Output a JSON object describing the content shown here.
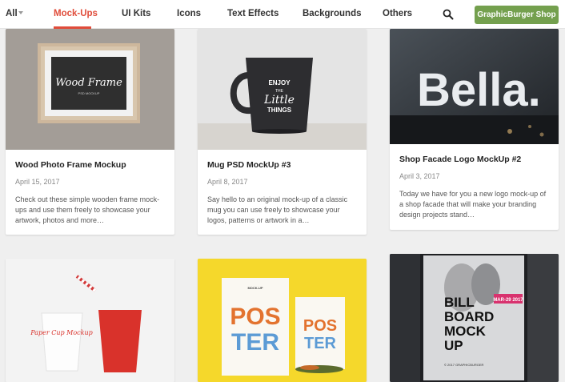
{
  "nav": {
    "all_label": "All",
    "items": [
      {
        "label": "Mock-Ups"
      },
      {
        "label": "UI Kits"
      },
      {
        "label": "Icons"
      },
      {
        "label": "Text Effects"
      },
      {
        "label": "Backgrounds"
      },
      {
        "label": "Others"
      }
    ],
    "shop_button": "GraphicBurger Shop"
  },
  "cards": [
    {
      "title": "Wood Photo Frame Mockup",
      "date": "April 15, 2017",
      "description": "Check out these simple wooden frame mock-ups and use them freely to showcase your artwork, photos and more…",
      "thumb_text": "Wood Frame",
      "thumb_subtext": "PSD MOCKUP"
    },
    {
      "title": "Mug PSD MockUp #3",
      "date": "April 8, 2017",
      "description": "Say hello to an original mock-up of a classic mug you can use freely to showcase your logos, patterns or artwork in a…",
      "thumb_text_1": "ENJOY",
      "thumb_text_2": "THE",
      "thumb_text_3": "Little",
      "thumb_text_4": "THINGS"
    },
    {
      "title": "Shop Facade Logo MockUp #2",
      "date": "April 3, 2017",
      "description": "Today we have for you a new logo mock-up of a shop facade that will make your branding design projects stand…",
      "thumb_text": "Bella."
    },
    {
      "thumb_text": "Paper Cup Mockup"
    },
    {
      "thumb_text_1": "POS",
      "thumb_text_2": "TER",
      "thumb_label": "MOCK-UP"
    },
    {
      "thumb_text_1": "BILL",
      "thumb_text_2": "BOARD",
      "thumb_text_3": "MOCK",
      "thumb_text_4": "UP",
      "thumb_date": "MAR-29 2017",
      "thumb_footer": "© 2017 GRAPHICBURGER"
    }
  ],
  "colors": {
    "accent": "#e04c3a",
    "shop_button": "#74a04e"
  }
}
